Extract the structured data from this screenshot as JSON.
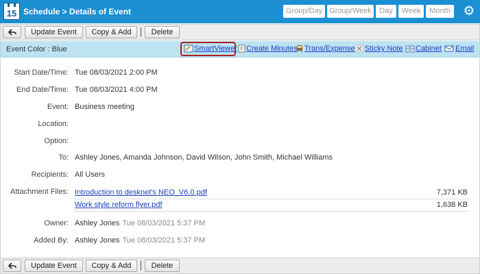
{
  "header": {
    "calendar_day": "15",
    "title": "Schedule > Details of Event",
    "views": [
      "Group/Day",
      "Group/Week",
      "Day",
      "Week",
      "Month"
    ]
  },
  "toolbar": {
    "update_label": "Update Event",
    "copy_label": "Copy & Add",
    "delete_label": "Delete"
  },
  "color_bar": {
    "label": "Event Color : Blue",
    "actions": {
      "smartviewer": "SmartViewer",
      "create_minutes": "Create Minutes",
      "trans_expense": "Trans/Expense",
      "sticky_note": "Sticky Note",
      "cabinet": "Cabinet",
      "email": "Email"
    }
  },
  "details": {
    "start": {
      "label": "Start Date/Time:",
      "value": "Tue 08/03/2021 2:00 PM"
    },
    "end": {
      "label": "End Date/Time:",
      "value": "Tue 08/03/2021 4:00 PM"
    },
    "event": {
      "label": "Event:",
      "value": "Business meeting"
    },
    "location": {
      "label": "Location:",
      "value": ""
    },
    "option": {
      "label": "Option:",
      "value": ""
    },
    "to": {
      "label": "To:",
      "value": "Ashley Jones, Amanda Johnson, David Wilson, John Smith, Michael Williams"
    },
    "recipients": {
      "label": "Recipients:",
      "value": "All Users"
    },
    "attachments": {
      "label": "Attachment Files:",
      "files": [
        {
          "name": "Introduction to desknet's NEO_V6.0.pdf",
          "size": "7,371 KB"
        },
        {
          "name": "Work style reform flyer.pdf",
          "size": "1,638 KB"
        }
      ]
    },
    "owner": {
      "label": "Owner:",
      "name": "Ashley Jones",
      "time": "Tue 08/03/2021 5:37 PM"
    },
    "added_by": {
      "label": "Added By:",
      "name": "Ashley Jones",
      "time": "Tue 08/03/2021 5:37 PM"
    }
  }
}
